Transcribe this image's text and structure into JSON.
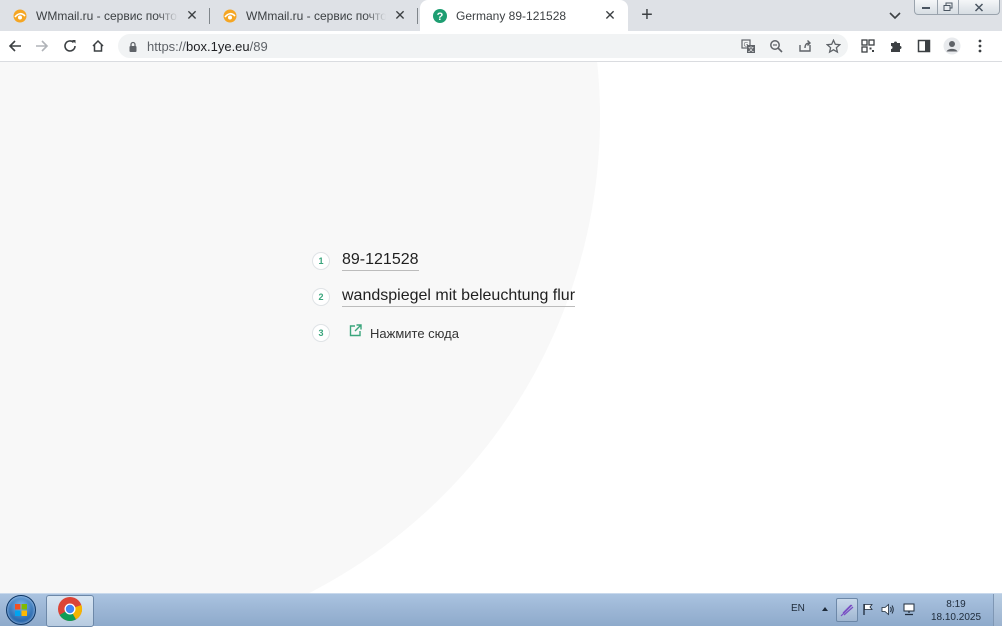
{
  "browser": {
    "tabs": [
      {
        "title": "WMmail.ru - сервис почтовых рассылок",
        "icon": "wmmail-favicon-icon",
        "active": false
      },
      {
        "title": "WMmail.ru - сервис почтовых рассылок",
        "icon": "wmmail-favicon-icon",
        "active": false
      },
      {
        "title": "Germany 89-121528",
        "icon": "help-circle-icon",
        "active": true
      }
    ],
    "address": {
      "scheme": "https://",
      "host": "box.1ye.eu",
      "path": "/89"
    }
  },
  "page": {
    "items": [
      {
        "number": "1",
        "text": "89-121528"
      },
      {
        "number": "2",
        "text": "wandspiegel mit beleuchtung flur"
      },
      {
        "number": "3",
        "text": "Нажмите сюда"
      }
    ],
    "accent_color": "#3aa57c"
  },
  "taskbar": {
    "language": "EN",
    "time": "8:19",
    "date": "18.10.2025"
  }
}
